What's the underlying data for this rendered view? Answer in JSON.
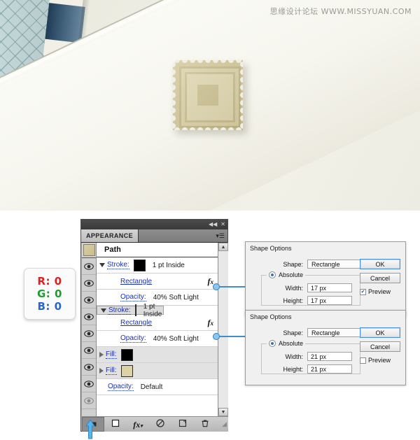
{
  "artwork": {
    "watermark": "思缘设计论坛  WWW.MISSYUAN.COM",
    "stamp_label": "postage-stamp"
  },
  "rgb_card": {
    "r": "R: 0",
    "g": "G: 0",
    "b": "B: 0"
  },
  "panel": {
    "tab_label": "APPEARANCE",
    "collapse_icon": "◀◀",
    "close_icon": "✕",
    "menu_icon": "▾☰",
    "header_row": {
      "label": "Path"
    },
    "rows": [
      {
        "type": "stroke",
        "disclosure": "down",
        "label": "Stroke:",
        "swatch": "#000000",
        "value": "1 pt  Inside"
      },
      {
        "type": "effect",
        "disclosure": "none",
        "label": "Rectangle",
        "value": "",
        "fx": "fx"
      },
      {
        "type": "opacity",
        "disclosure": "none",
        "label": "Opacity:",
        "value": "40% Soft Light"
      },
      {
        "type": "stroke",
        "disclosure": "down",
        "label": "Stroke:",
        "swatch": "#000000",
        "value": "1 pt  Inside"
      },
      {
        "type": "effect",
        "disclosure": "none",
        "label": "Rectangle",
        "value": "",
        "fx": "fx"
      },
      {
        "type": "opacity",
        "disclosure": "none",
        "label": "Opacity:",
        "value": "40% Soft Light"
      },
      {
        "type": "fill",
        "disclosure": "right",
        "label": "Fill:",
        "swatch": "#000000",
        "value": ""
      },
      {
        "type": "fill",
        "disclosure": "right",
        "label": "Fill:",
        "swatch": "#ddd2a6",
        "value": ""
      },
      {
        "type": "opacity",
        "disclosure": "none",
        "label": "Opacity:",
        "value": "Default"
      }
    ],
    "scroll_up": "▲",
    "scroll_down": "▼",
    "footer_buttons": [
      {
        "name": "add-new-stroke",
        "icon": "stroke-square",
        "active": true
      },
      {
        "name": "add-new-fill",
        "icon": "fill-square",
        "active": false
      },
      {
        "name": "add-new-effect",
        "icon": "fx",
        "active": false
      },
      {
        "name": "clear-appearance",
        "icon": "no-symbol",
        "active": false
      },
      {
        "name": "duplicate-item",
        "icon": "duplicate",
        "active": false
      },
      {
        "name": "delete-item",
        "icon": "trash",
        "active": false
      }
    ],
    "resize_grip": "◢"
  },
  "dialogs": [
    {
      "title": "Shape Options",
      "shape_label": "Shape:",
      "shape_value": "Rectangle",
      "absolute_label": "Absolute",
      "absolute_selected": true,
      "width_label": "Width:",
      "width_value": "17 px",
      "height_label": "Height:",
      "height_value": "17 px",
      "ok_label": "OK",
      "cancel_label": "Cancel",
      "preview_label": "Preview",
      "preview_checked": true
    },
    {
      "title": "Shape Options",
      "shape_label": "Shape:",
      "shape_value": "Rectangle",
      "absolute_label": "Absolute",
      "absolute_selected": true,
      "width_label": "Width:",
      "width_value": "21 px",
      "height_label": "Height:",
      "height_value": "21 px",
      "ok_label": "OK",
      "cancel_label": "Cancel",
      "preview_label": "Preview",
      "preview_checked": false
    }
  ],
  "colors": {
    "accent_blue": "#3f8ed0",
    "link_blue": "#1c32b4",
    "panel_gray": "#d6d6d6",
    "stamp_tan": "#cfc392",
    "airmail_red": "#c2514a",
    "airmail_blue": "#30506c"
  }
}
